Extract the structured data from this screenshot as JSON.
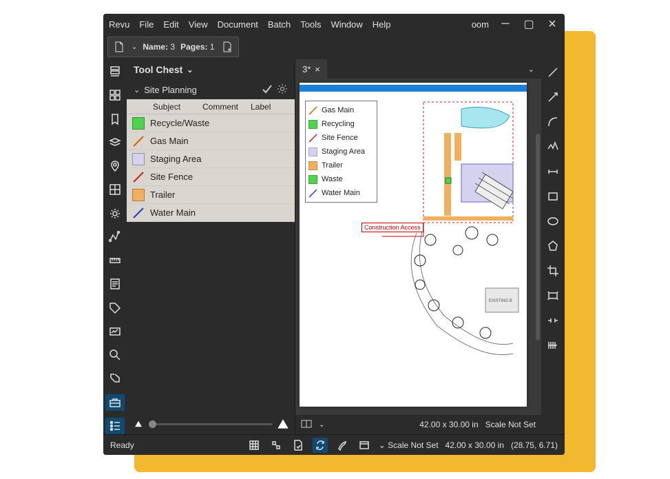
{
  "menu": {
    "items": [
      "Revu",
      "File",
      "Edit",
      "View",
      "Document",
      "Batch",
      "Tools",
      "Window",
      "Help"
    ],
    "oom_suffix": "oom"
  },
  "filebar": {
    "name_label": "Name:",
    "name_value": "3",
    "pages_label": "Pages:",
    "pages_value": "1"
  },
  "panel": {
    "title": "Tool Chest",
    "section": "Site Planning",
    "columns": [
      "Subject",
      "Comment",
      "Label"
    ],
    "rows": [
      {
        "label": "Recycle/Waste",
        "type": "fill",
        "color": "#4fd24f"
      },
      {
        "label": "Gas Main",
        "type": "line",
        "color": "#e05a00"
      },
      {
        "label": "Staging Area",
        "type": "fill",
        "color": "#d4d2ef"
      },
      {
        "label": "Site Fence",
        "type": "line",
        "color": "#d01818"
      },
      {
        "label": "Trailer",
        "type": "fill",
        "color": "#f0b060"
      },
      {
        "label": "Water Main",
        "type": "line",
        "color": "#2040c0"
      }
    ]
  },
  "tab": {
    "label": "3*"
  },
  "legend": [
    {
      "label": "Gas Main",
      "type": "line",
      "color": "#e05a00"
    },
    {
      "label": "Recycling",
      "type": "fill",
      "color": "#4fd24f"
    },
    {
      "label": "Site Fence",
      "type": "line",
      "color": "#d01818"
    },
    {
      "label": "Staging Area",
      "type": "fill",
      "color": "#d4d2ef"
    },
    {
      "label": "Trailer",
      "type": "fill",
      "color": "#f0b060"
    },
    {
      "label": "Waste",
      "type": "fill",
      "color": "#4fd24f"
    },
    {
      "label": "Water Main",
      "type": "line",
      "color": "#2040c0"
    }
  ],
  "construction_label": "Construction Access",
  "existing_label": "EXISTING B",
  "docstatus": {
    "dims": "42.00 x 30.00 in",
    "scale": "Scale Not Set"
  },
  "statusbar": {
    "ready": "Ready",
    "scale_dd": "Scale Not Set",
    "dims": "42.00 x 30.00 in",
    "coords": "(28.75, 6.71)"
  }
}
